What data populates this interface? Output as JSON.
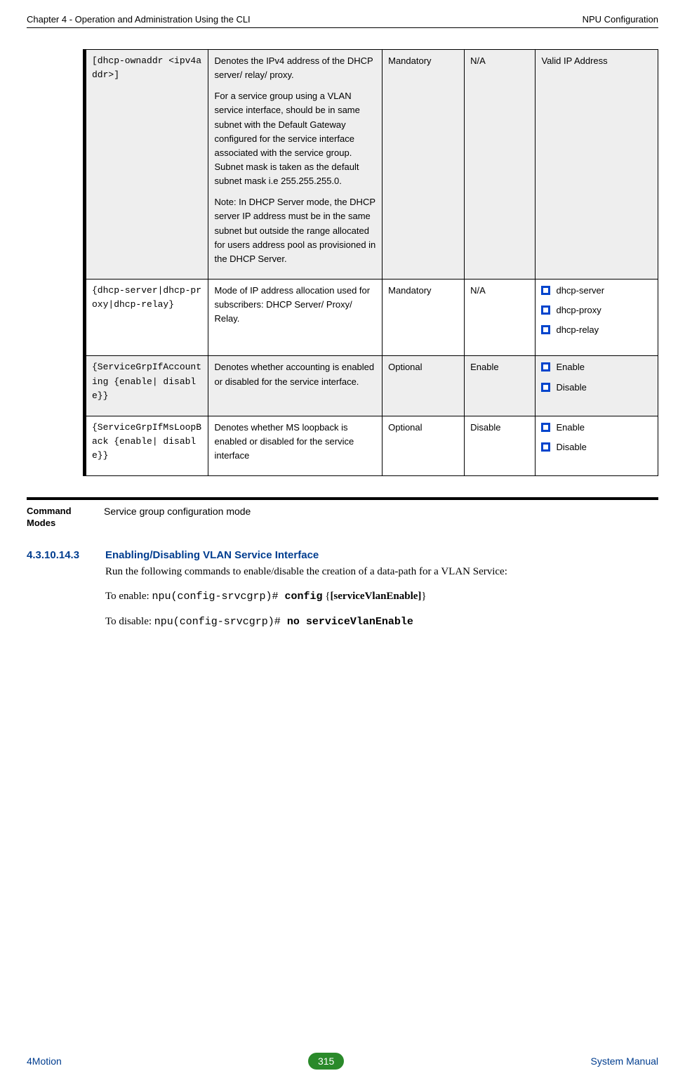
{
  "header": {
    "left": "Chapter 4 - Operation and Administration Using the CLI",
    "right": "NPU Configuration"
  },
  "table": {
    "rows": [
      {
        "param": "[dhcp-ownaddr <ipv4addr>]",
        "desc_p1": "Denotes the IPv4 address of the DHCP server/ relay/ proxy.",
        "desc_p2": "For a service group using a VLAN service interface, should be in same subnet with the Default Gateway configured for the service interface associated with the service group. Subnet mask is taken as the default subnet mask i.e 255.255.255.0.",
        "desc_p3": "Note: In DHCP Server mode, the DHCP server IP address must be in the same subnet but outside the range allocated for users address pool as provisioned in the DHCP Server.",
        "presence": "Mandatory",
        "default": "N/A",
        "values_text": "Valid IP Address",
        "values_list": []
      },
      {
        "param": "{dhcp-server|dhcp-proxy|dhcp-relay}",
        "desc_p1": "Mode of IP address allocation used for subscribers: DHCP Server/ Proxy/ Relay.",
        "desc_p2": "",
        "desc_p3": "",
        "presence": "Mandatory",
        "default": "N/A",
        "values_text": "",
        "values_list": [
          "dhcp-server",
          "dhcp-proxy",
          "dhcp-relay"
        ]
      },
      {
        "param": "{ServiceGrpIfAccounting {enable| disable}}",
        "desc_p1": "Denotes whether accounting is enabled or disabled for the service interface.",
        "desc_p2": "",
        "desc_p3": "",
        "presence": "Optional",
        "default": "Enable",
        "values_text": "",
        "values_list": [
          "Enable",
          "Disable"
        ]
      },
      {
        "param": "{ServiceGrpIfMsLoopBack {enable| disable}}",
        "desc_p1": "Denotes whether MS loopback  is enabled or disabled for the service interface",
        "desc_p2": "",
        "desc_p3": "",
        "presence": "Optional",
        "default": "Disable",
        "values_text": "",
        "values_list": [
          "Enable",
          "Disable"
        ]
      }
    ]
  },
  "modes": {
    "label_l1": "Command",
    "label_l2": "Modes",
    "text": "Service group configuration mode"
  },
  "section": {
    "number": "4.3.10.14.3",
    "title": "Enabling/Disabling VLAN Service Interface",
    "intro": "Run the following commands to enable/disable the creation of a data-path for a VLAN Service:",
    "enable_prefix": "To enable:  ",
    "enable_cmd_prompt": "npu(config-srvcgrp)# ",
    "enable_cmd_word": "config",
    "enable_cmd_arg_open": " {",
    "enable_cmd_arg": "[serviceVlanEnable]",
    "enable_cmd_arg_close": "}",
    "disable_prefix": "To disable: ",
    "disable_cmd_prompt": "npu(config-srvcgrp)# ",
    "disable_cmd_rest": "no serviceVlanEnable"
  },
  "footer": {
    "left": "4Motion",
    "page": "315",
    "right": "System Manual"
  }
}
